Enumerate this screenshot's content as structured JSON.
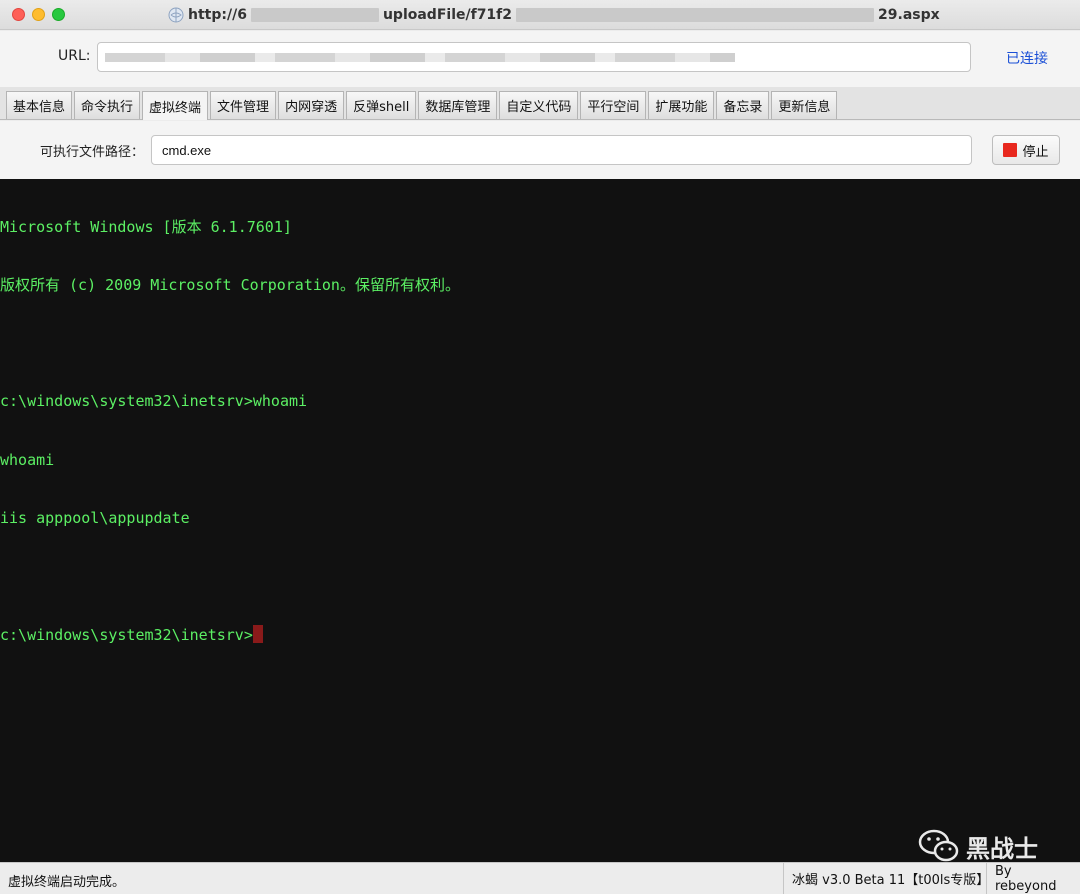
{
  "window": {
    "title_prefix": "http://6",
    "title_mid": "uploadFile/f71f2",
    "title_suffix": "29.aspx"
  },
  "url_bar": {
    "label": "URL:",
    "value": "",
    "status": "已连接"
  },
  "tabs": [
    {
      "label": "基本信息",
      "active": false
    },
    {
      "label": "命令执行",
      "active": false
    },
    {
      "label": "虚拟终端",
      "active": true
    },
    {
      "label": "文件管理",
      "active": false
    },
    {
      "label": "内网穿透",
      "active": false
    },
    {
      "label": "反弹shell",
      "active": false
    },
    {
      "label": "数据库管理",
      "active": false
    },
    {
      "label": "自定义代码",
      "active": false
    },
    {
      "label": "平行空间",
      "active": false
    },
    {
      "label": "扩展功能",
      "active": false
    },
    {
      "label": "备忘录",
      "active": false
    },
    {
      "label": "更新信息",
      "active": false
    }
  ],
  "exec_path": {
    "label": "可执行文件路径：",
    "value": "cmd.exe",
    "stop_label": "停止"
  },
  "terminal": {
    "lines": [
      "Microsoft Windows [版本 6.1.7601]",
      "版权所有 (c) 2009 Microsoft Corporation。保留所有权利。",
      "",
      "c:\\windows\\system32\\inetsrv>whoami",
      "whoami",
      "iis apppool\\appupdate",
      ""
    ],
    "prompt": "c:\\windows\\system32\\inetsrv>",
    "text_color": "#5cf064",
    "background": "#111111"
  },
  "watermark": {
    "text": "黑战士",
    "icon": "wechat-icon"
  },
  "status_bar": {
    "message": "虚拟终端启动完成。",
    "version": "冰蝎 v3.0 Beta 11【t00ls专版】",
    "author": "By rebeyond"
  }
}
